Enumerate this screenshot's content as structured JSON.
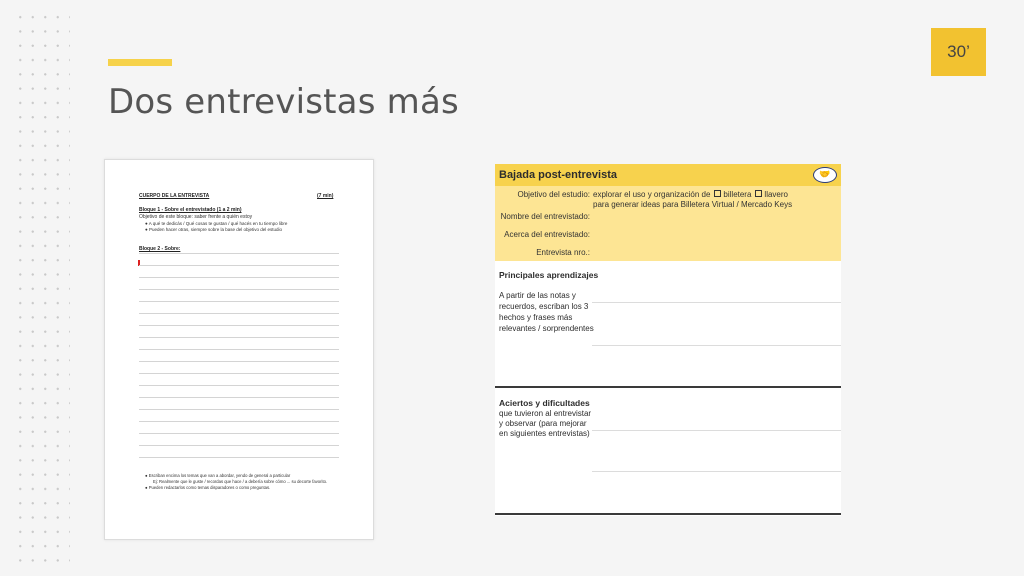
{
  "slide": {
    "title": "Dos entrevistas más",
    "timer": "30’",
    "accent_color": "#f6d24a",
    "timer_color": "#f2c230"
  },
  "doc1": {
    "heading": "CUERPO DE LA ENTREVISTA",
    "duration": "(7 min)",
    "bloque1": "Bloque 1 - Sobre el entrevistado (1 a 2 min)",
    "objetivo": "Objetivo de este bloque: saber frente a quién estoy",
    "bullets": [
      "A qué te dedicás / Qué cosas te gustan / qué hacés en tu tiempo libre",
      "Pueden hacer otras, siempre sobre la base del objetivo del estudio"
    ],
    "bloque2": "Bloque 2 - Sobre:",
    "notes": [
      "Escriban encima los temas que van a abordar, yendo de general a particular",
      "Ej: Realmente que le guste / recordas que hace / a debería sobre cómo ... su decorte favorito.",
      "Pueden redactarlos como temas disparadores o como preguntas."
    ]
  },
  "doc2": {
    "title": "Bajada post-entrevista",
    "logo_icon": "handshake-logo-icon",
    "fields": [
      {
        "label": "Objetivo del estudio:",
        "value": "explorar el uso y organización de"
      },
      {
        "label": "Nombre del entrevistado:",
        "value": ""
      },
      {
        "label": "Acerca del entrevistado:",
        "value": ""
      },
      {
        "label": "Entrevista nro.:",
        "value": ""
      }
    ],
    "option1": "billetera",
    "option2": "llavero",
    "objective_line2": "para generar ideas para Billetera Virtual / Mercado Keys",
    "sections": [
      {
        "title": "Principales aprendizajes",
        "desc": [
          "A partir de las notas y",
          "recuerdos, escriban los 3",
          "hechos y frases más",
          "relevantes / sorprendentes"
        ]
      },
      {
        "title": "Aciertos y dificultades",
        "desc": [
          "que tuvieron al entrevistar",
          "y observar (para mejorar",
          "en siguientes entrevistas)"
        ]
      }
    ],
    "header_color": "#f7d24d",
    "header_light_color": "#fde594"
  }
}
